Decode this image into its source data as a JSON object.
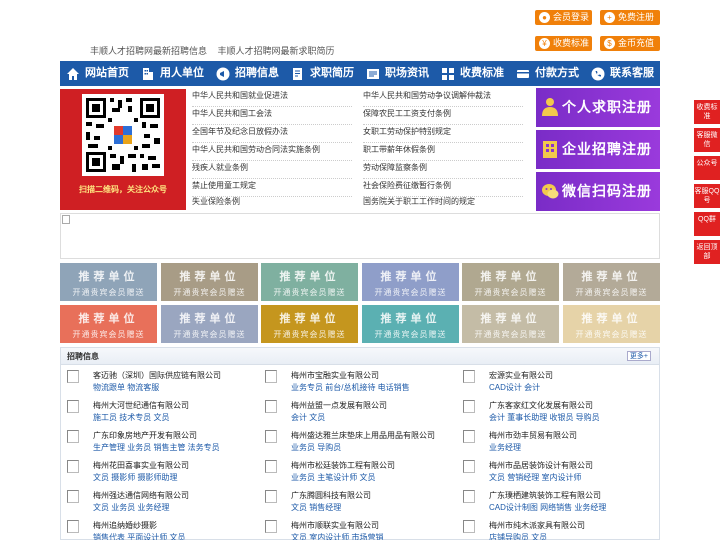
{
  "header": {
    "links": [
      "丰顺人才招聘网最新招聘信息",
      "丰顺人才招聘网最新求职简历"
    ],
    "buttons": [
      {
        "label": "会员登录",
        "icon": "user-icon"
      },
      {
        "label": "免费注册",
        "icon": "person-add-icon"
      },
      {
        "label": "收费标准",
        "icon": "yen-icon"
      },
      {
        "label": "金币充值",
        "icon": "coin-icon"
      }
    ]
  },
  "nav": {
    "items": [
      {
        "label": "网站首页",
        "icon": "home-icon"
      },
      {
        "label": "用人单位",
        "icon": "building-icon"
      },
      {
        "label": "招聘信息",
        "icon": "megaphone-icon"
      },
      {
        "label": "求职简历",
        "icon": "pen-icon"
      },
      {
        "label": "职场资讯",
        "icon": "news-icon"
      },
      {
        "label": "收费标准",
        "icon": "grid-icon"
      },
      {
        "label": "付款方式",
        "icon": "card-icon"
      },
      {
        "label": "联系客服",
        "icon": "phone-icon"
      }
    ]
  },
  "qr": {
    "caption": "扫描二维码，关注公众号"
  },
  "laws": [
    "中华人民共和国就业促进法",
    "中华人民共和国劳动争议调解仲裁法",
    "中华人民共和国工会法",
    "保障农民工工资支付条例",
    "全国年节及纪念日放假办法",
    "女职工劳动保护特别规定",
    "中华人民共和国劳动合同法实施条例",
    "职工带薪年休假条例",
    "残疾人就业条例",
    "劳动保障监察条例",
    "禁止使用童工规定",
    "社会保险费征缴暂行条例",
    "失业保险条例",
    "国务院关于职工工作时间的规定"
  ],
  "register": [
    {
      "label": "个人求职注册",
      "icon": "person-icon"
    },
    {
      "label": "企业招聘注册",
      "icon": "enterprise-icon"
    },
    {
      "label": "微信扫码注册",
      "icon": "wechat-icon"
    }
  ],
  "recommend": {
    "title": "推荐单位",
    "subtitle": "开通贵宾会员赠送",
    "colors": [
      "#8fa4b8",
      "#a89c86",
      "#7fb0a0",
      "#8f9ec9",
      "#b0a890",
      "#b3aa98",
      "#e8705a",
      "#9aa6c0",
      "#c5961e",
      "#5bb0b2",
      "#c4bca6",
      "#e6d3a8"
    ]
  },
  "jobs": {
    "title": "招聘信息",
    "more": "更多+",
    "companies": [
      {
        "name": "客迈驰（深圳）国际供应链有限公司",
        "posts": "物流跟单 物流客服"
      },
      {
        "name": "梅州市宝融实业有限公司",
        "posts": "业务专员 前台/总机接待 电话销售"
      },
      {
        "name": "宏源实业有限公司",
        "posts": "CAD设计 会计"
      },
      {
        "name": "梅州大河世纪通信有限公司",
        "posts": "施工员 技术专员 文员"
      },
      {
        "name": "梅州益盟一点发展有限公司",
        "posts": "会计 文员"
      },
      {
        "name": "广东客家红文化发展有限公司",
        "posts": "会计 董事长助理 收银员 导购员"
      },
      {
        "name": "广东印象房地产开发有限公司",
        "posts": "生产管理 业务员 销售主管 法务专员"
      },
      {
        "name": "梅州盛达雅兰床垫床上用品用品有限公司",
        "posts": "业务员 导购员"
      },
      {
        "name": "梅州市劲丰贸易有限公司",
        "posts": "业务经理"
      },
      {
        "name": "梅州花田喜事实业有限公司",
        "posts": "文员 摄影师 摄影师助理"
      },
      {
        "name": "梅州市松廷装饰工程有限公司",
        "posts": "业务员 主笔设计师 文员"
      },
      {
        "name": "梅州市品居装饰设计有限公司",
        "posts": "文员 营销经理 室内设计师"
      },
      {
        "name": "梅州强达通信网络有限公司",
        "posts": "文员 业务员 业务经理"
      },
      {
        "name": "广东腾圆科技有限公司",
        "posts": "文员 销售经理"
      },
      {
        "name": "广东璞栖建筑装饰工程有限公司",
        "posts": "CAD设计制图 网络销售 业务经理"
      },
      {
        "name": "梅州追纳婚纱摄影",
        "posts": "销售代表 平面设计师 文员"
      },
      {
        "name": "梅州市顺联实业有限公司",
        "posts": "文员 室内设计师 市场营销"
      },
      {
        "name": "梅州市纯木派家具有限公司",
        "posts": "店铺导购员 文员"
      }
    ]
  },
  "side": [
    {
      "label": "收费标准"
    },
    {
      "label": "客服微信"
    },
    {
      "label": "公众号"
    },
    {
      "label": "客服QQ号"
    },
    {
      "label": "QQ群"
    },
    {
      "label": "返回顶部"
    }
  ]
}
